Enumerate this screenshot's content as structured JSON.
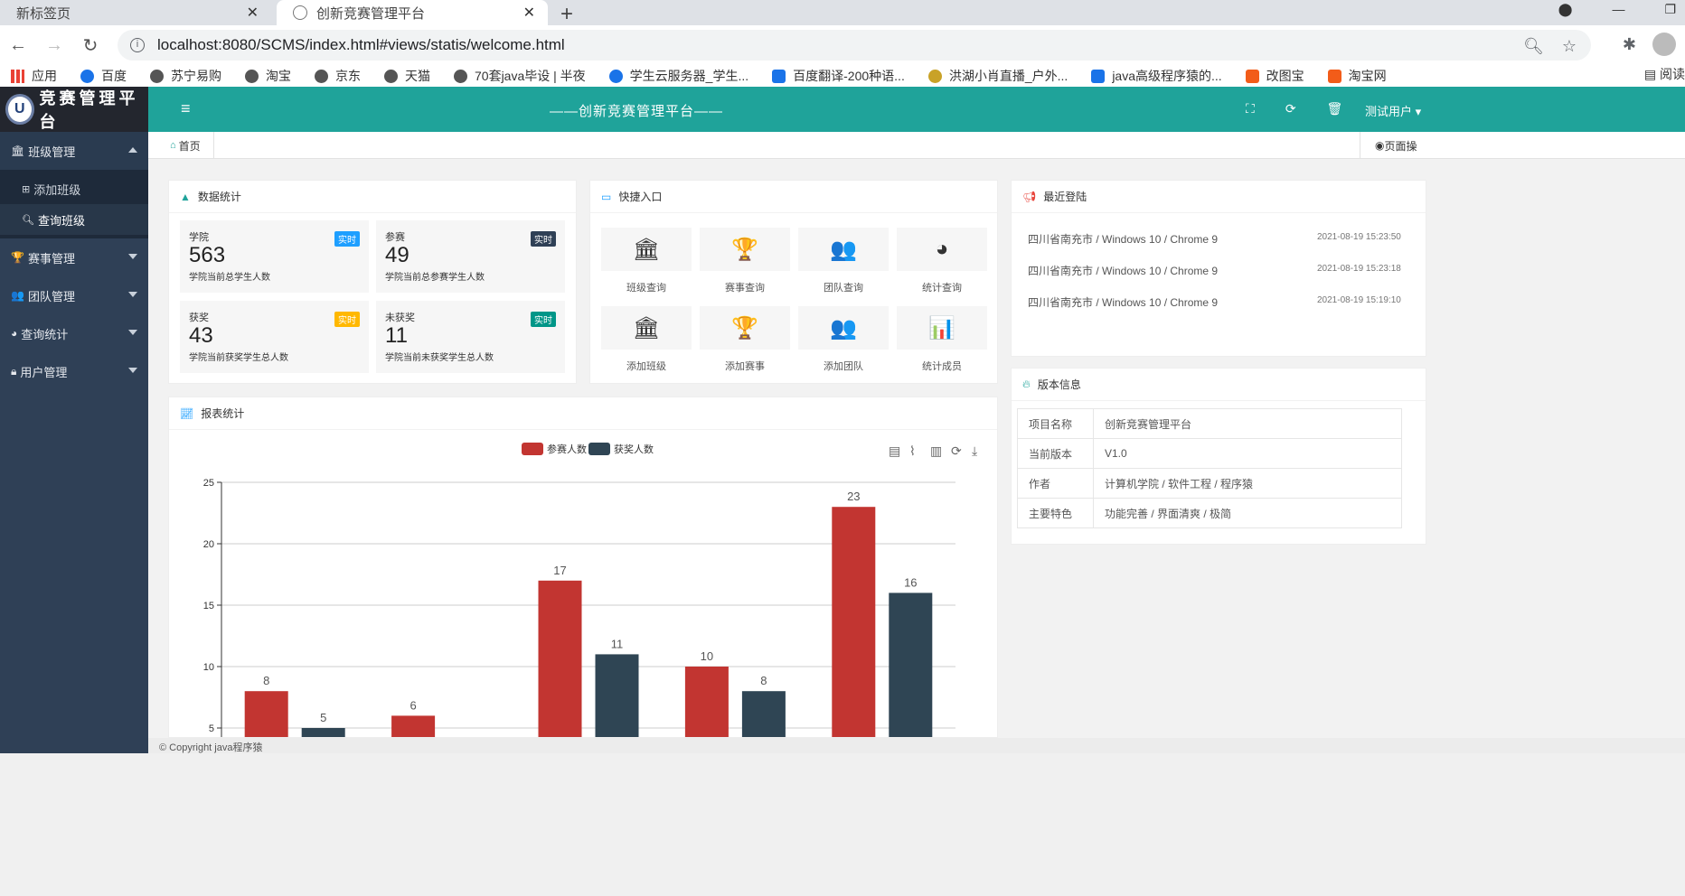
{
  "browser": {
    "tabs": [
      {
        "title": "新标签页",
        "active": false
      },
      {
        "title": "创新竞赛管理平台",
        "active": true
      }
    ],
    "url": "localhost:8080/SCMS/index.html#views/statis/welcome.html",
    "bookmarks": [
      {
        "label": "应用",
        "icon": "apps-grid-icon"
      },
      {
        "label": "百度",
        "icon": "baidu-icon"
      },
      {
        "label": "苏宁易购",
        "icon": "globe-icon"
      },
      {
        "label": "淘宝",
        "icon": "globe-icon"
      },
      {
        "label": "京东",
        "icon": "globe-icon"
      },
      {
        "label": "天猫",
        "icon": "globe-icon"
      },
      {
        "label": "70套java毕设 | 半夜",
        "icon": "globe-icon"
      },
      {
        "label": "学生云服务器_学生...",
        "icon": "cloud-icon"
      },
      {
        "label": "百度翻译-200种语...",
        "icon": "translate-icon"
      },
      {
        "label": "洪湖小肖直播_户外...",
        "icon": "live-icon"
      },
      {
        "label": "java高级程序猿的...",
        "icon": "bilibili-icon"
      },
      {
        "label": "改图宝",
        "icon": "image-edit-icon"
      },
      {
        "label": "淘宝网",
        "icon": "taobao-icon"
      }
    ],
    "bookmarks_more": "»",
    "reading_list": "阅读"
  },
  "sidebar": {
    "brand": "竞赛管理平台",
    "menus": [
      {
        "label": "班级管理",
        "open": true,
        "items": [
          {
            "label": "添加班级",
            "active": false
          },
          {
            "label": "查询班级",
            "active": true
          }
        ]
      },
      {
        "label": "赛事管理",
        "open": false,
        "items": []
      },
      {
        "label": "团队管理",
        "open": false,
        "items": []
      },
      {
        "label": "查询统计",
        "open": false,
        "items": []
      },
      {
        "label": "用户管理",
        "open": false,
        "items": []
      }
    ]
  },
  "topbar": {
    "title": "——创新竞赛管理平台——",
    "user": "测试用户"
  },
  "tabs_row": {
    "home": "首页",
    "page_ops": "页面操"
  },
  "stats_card": {
    "title": "数据统计",
    "items": [
      {
        "label": "学院",
        "badge": "实时",
        "badge_color": "#1e9fff",
        "value": "563",
        "desc": "学院当前总学生人数"
      },
      {
        "label": "参赛",
        "badge": "实时",
        "badge_color": "#2f4056",
        "value": "49",
        "desc": "学院当前总参赛学生人数"
      },
      {
        "label": "获奖",
        "badge": "实时",
        "badge_color": "#ffb800",
        "value": "43",
        "desc": "学院当前获奖学生总人数"
      },
      {
        "label": "未获奖",
        "badge": "实时",
        "badge_color": "#009688",
        "value": "11",
        "desc": "学院当前未获奖学生总人数"
      }
    ]
  },
  "quick_card": {
    "title": "快捷入口",
    "items": [
      {
        "label": "班级查询",
        "icon": "bank-icon"
      },
      {
        "label": "赛事查询",
        "icon": "trophy-icon"
      },
      {
        "label": "团队查询",
        "icon": "group-icon"
      },
      {
        "label": "统计查询",
        "icon": "pie-chart-icon"
      },
      {
        "label": "添加班级",
        "icon": "bank-icon"
      },
      {
        "label": "添加赛事",
        "icon": "trophy-icon"
      },
      {
        "label": "添加团队",
        "icon": "group-icon"
      },
      {
        "label": "统计成员",
        "icon": "bar-chart-icon"
      }
    ]
  },
  "recent_card": {
    "title": "最近登陆",
    "rows": [
      {
        "place": "四川省南充市 / Windows 10 / Chrome 9",
        "time": "2021-08-19 15:23:50"
      },
      {
        "place": "四川省南充市 / Windows 10 / Chrome 9",
        "time": "2021-08-19 15:23:18"
      },
      {
        "place": "四川省南充市 / Windows 10 / Chrome 9",
        "time": "2021-08-19 15:19:10"
      }
    ]
  },
  "version_card": {
    "title": "版本信息",
    "rows": [
      {
        "key": "项目名称",
        "value": "创新竞赛管理平台"
      },
      {
        "key": "当前版本",
        "value": "V1.0"
      },
      {
        "key": "作者",
        "value": "计算机学院 / 软件工程 / 程序猿"
      },
      {
        "key": "主要特色",
        "value": "功能完善 / 界面清爽 / 极简"
      }
    ]
  },
  "report_card": {
    "title": "报表统计"
  },
  "footer": {
    "text": "© Copyright java程序猿"
  },
  "colors": {
    "accent": "#1fa39a",
    "sidebar": "#2f4056",
    "series1": "#c23531",
    "series2": "#2f4554"
  },
  "chart_data": {
    "type": "bar",
    "ylim": [
      5,
      25
    ],
    "yticks": [
      5,
      10,
      15,
      20,
      25
    ],
    "legend_position": "top-center",
    "series": [
      {
        "name": "参赛人数",
        "color": "#c23531",
        "values": [
          8,
          6,
          17,
          10,
          23
        ]
      },
      {
        "name": "获奖人数",
        "color": "#2f4554",
        "values": [
          5,
          null,
          11,
          8,
          16
        ]
      }
    ]
  }
}
